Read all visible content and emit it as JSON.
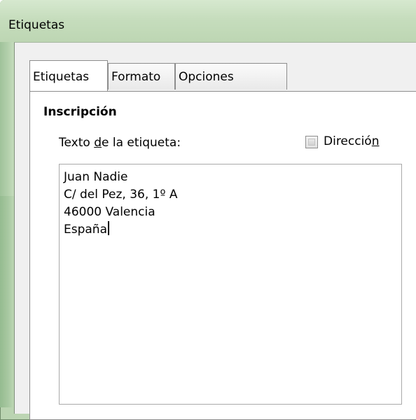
{
  "window": {
    "title": "Etiquetas"
  },
  "tabs": [
    {
      "label": "Etiquetas",
      "active": true
    },
    {
      "label": "Formato",
      "active": false
    },
    {
      "label": "Opciones",
      "active": false
    }
  ],
  "inscription": {
    "section_title": "Inscripción",
    "label_text_prefix": "Texto ",
    "label_text_accel": "d",
    "label_text_suffix": "e la etiqueta:",
    "direction_checkbox": {
      "label_prefix": "Direcció",
      "label_accel": "n",
      "checked": false
    },
    "textarea_lines": [
      "Juan Nadie",
      "C/ del Pez, 36, 1º A",
      "46000 Valencia",
      "España"
    ]
  }
}
